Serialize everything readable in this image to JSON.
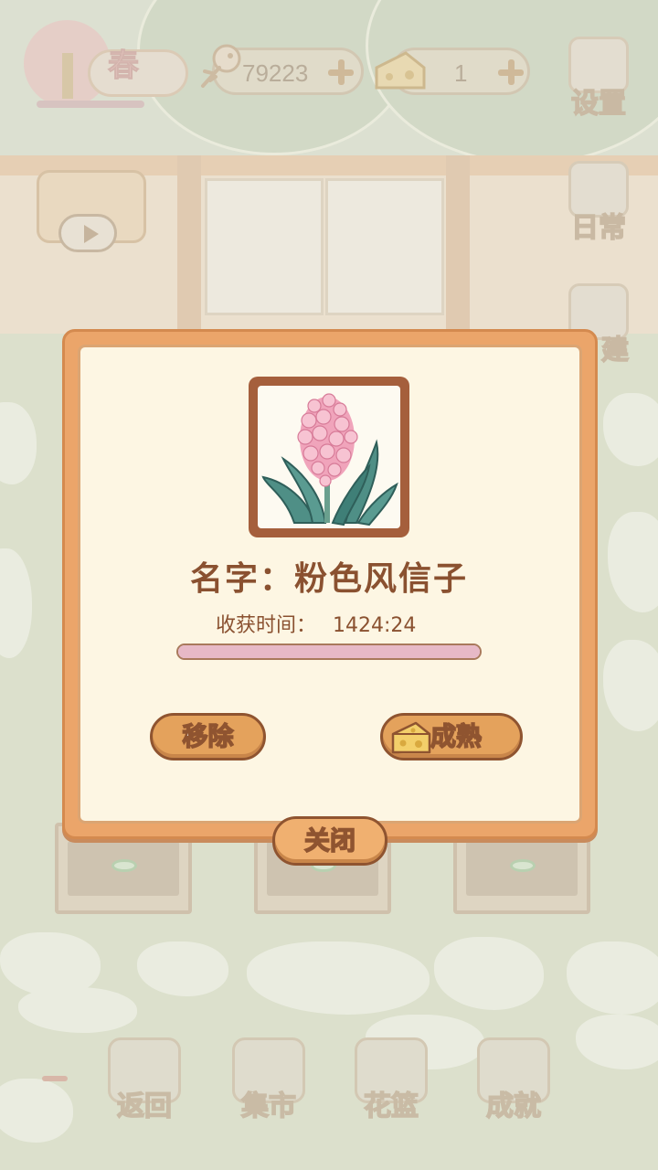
{
  "hud": {
    "season": "春",
    "fish_count": "79223",
    "cheese_count": "1",
    "settings_label": "设置",
    "daily_label": "日常",
    "build_label": "建"
  },
  "dialog": {
    "name_line": "名字：粉色风信子",
    "harvest_label": "收获时间：",
    "harvest_time": "1424:24",
    "progress_fraction": 1.0,
    "remove_label": "移除",
    "mature_label": "成熟",
    "close_label": "关闭"
  },
  "bottom_nav": [
    {
      "label": "返回",
      "icon": "window-icon"
    },
    {
      "label": "集市",
      "icon": "market-stall-icon"
    },
    {
      "label": "花篮",
      "icon": "flower-basket-icon"
    },
    {
      "label": "成就",
      "icon": "trophy-icon"
    }
  ],
  "colors": {
    "dialog_border": "#eba56a",
    "dialog_bg": "#fdf6e3",
    "button": "#e4a25c",
    "text_brown": "#8a5130",
    "progress_fill": "#e7b9c7"
  }
}
